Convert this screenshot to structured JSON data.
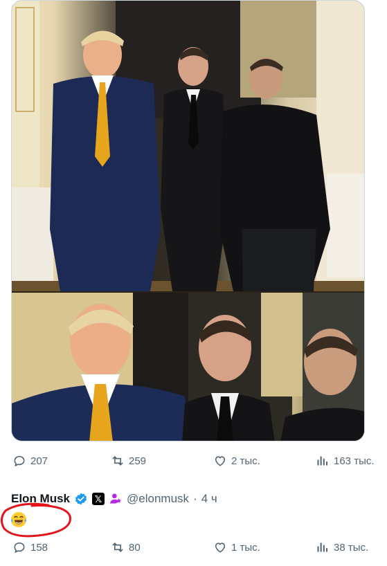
{
  "tweet_actions": {
    "replies": "207",
    "reposts": "259",
    "likes": "2 тыс.",
    "views": "163 тыс."
  },
  "reply": {
    "author_name": "Elon Musk",
    "x_badge": "𝕏",
    "handle": "@elonmusk",
    "separator": "·",
    "time": "4 ч",
    "emoji_icon": "face-with-tears-of-joy",
    "actions": {
      "replies": "158",
      "reposts": "80",
      "likes": "1 тыс.",
      "views": "38 тыс."
    }
  },
  "colors": {
    "icon_gray": "#536471",
    "verified_blue": "#1d9bf0",
    "affiliate_purple": "#b42ae3",
    "annotation_red": "#e3141b"
  }
}
